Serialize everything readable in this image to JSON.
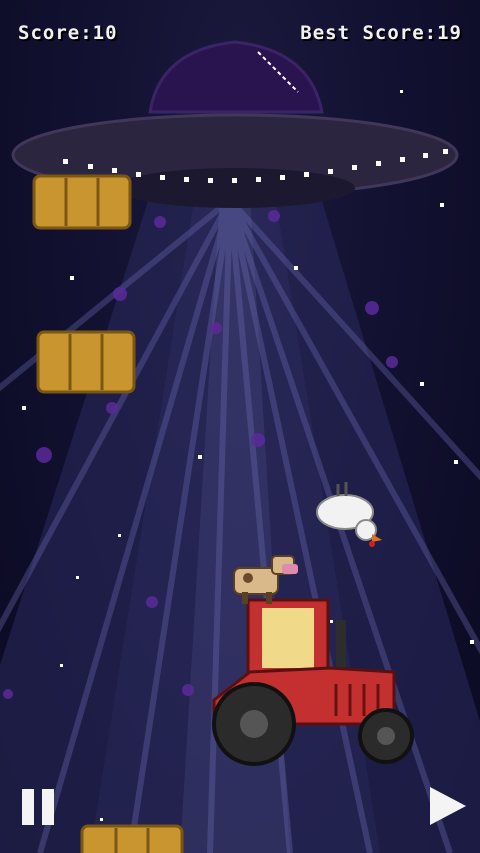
{
  "hud": {
    "score_text": "Score:10",
    "best_text": "Best Score:19"
  },
  "controls": {
    "pause_icon": "pause-icon",
    "play_icon": "play-icon"
  },
  "colors": {
    "sky": "#121131",
    "beam": "#3a3a78",
    "ufo_hull": "#2c2540",
    "ufo_dome": "#2a1450",
    "ufo_lights": "#ffffff",
    "hay": "#c9952e",
    "tractor_body": "#c43030",
    "tractor_window": "#f1d98a",
    "particles": "#5b2a9a"
  }
}
